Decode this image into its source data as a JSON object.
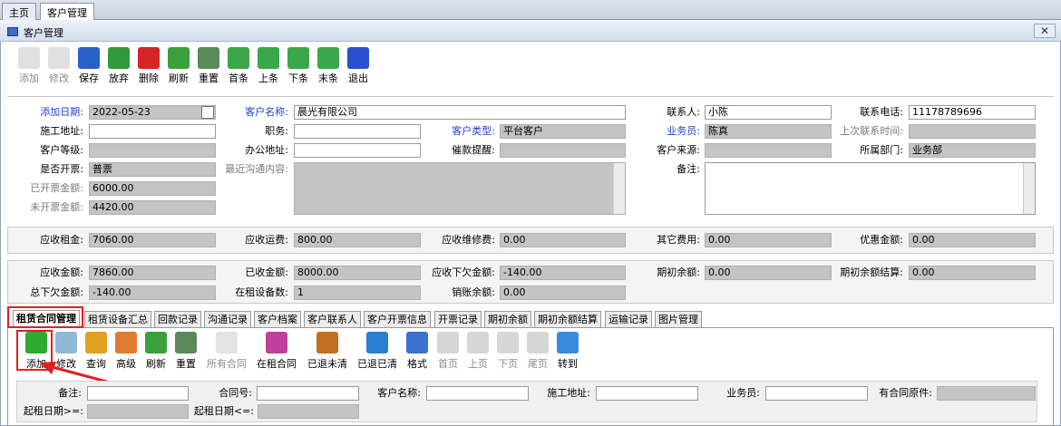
{
  "top_tabs": [
    "主页",
    "客户管理"
  ],
  "window_title": "客户管理",
  "close_glyph": "✕",
  "toolbar": [
    "添加",
    "修改",
    "保存",
    "放弃",
    "删除",
    "刷新",
    "重置",
    "首条",
    "上条",
    "下条",
    "末条",
    "退出"
  ],
  "colors": {
    "accent_blue": "#1e3fd0",
    "highlight_red": "#e02020",
    "add_green": "#2eaa2e"
  },
  "form": {
    "add_date_label": "添加日期:",
    "add_date": "2022-05-23",
    "customer_name_label": "客户名称:",
    "customer_name": "晨光有限公司",
    "contact_label": "联系人:",
    "contact": "小陈",
    "phone_label": "联系电话:",
    "phone": "11178789696",
    "site_address_label": "施工地址:",
    "site_address": "",
    "position_label": "职务:",
    "position": "",
    "customer_type_label": "客户类型:",
    "customer_type": "平台客户",
    "salesman_label": "业务员:",
    "salesman": "陈真",
    "last_contact_label": "上次联系时间:",
    "last_contact": "",
    "customer_level_label": "客户等级:",
    "customer_level": "",
    "office_address_label": "办公地址:",
    "office_address": "",
    "reminder_label": "催款提醒:",
    "reminder": "",
    "source_label": "客户来源:",
    "source": "",
    "department_label": "所属部门:",
    "department": "业务部",
    "invoice_label": "是否开票:",
    "invoice": "普票",
    "recent_comm_label": "最近沟通内容:",
    "recent_comm": "",
    "remark_label": "备注:",
    "remark": "",
    "invoiced_amount_label": "已开票金额:",
    "invoiced_amount": "6000.00",
    "uninvoiced_amount_label": "未开票金额:",
    "uninvoiced_amount": "4420.00"
  },
  "fees": {
    "rent_label": "应收租金:",
    "rent": "7060.00",
    "freight_label": "应收运费:",
    "freight": "800.00",
    "repair_label": "应收维修费:",
    "repair": "0.00",
    "other_label": "其它费用:",
    "other": "0.00",
    "discount_label": "优惠金额:",
    "discount": "0.00"
  },
  "summary": {
    "receivable_label": "应收金额:",
    "receivable": "7860.00",
    "received_label": "已收金额:",
    "received": "8000.00",
    "owed_label": "应收下欠金额:",
    "owed": "-140.00",
    "opening_label": "期初余额:",
    "opening": "0.00",
    "opening_settled_label": "期初余额结算:",
    "opening_settled": "0.00",
    "total_owed_label": "总下欠金额:",
    "total_owed": "-140.00",
    "equipment_label": "在租设备数:",
    "equipment": "1",
    "writeoff_label": "销账余额:",
    "writeoff": "0.00"
  },
  "sub_tabs": [
    "租赁合同管理",
    "租赁设备汇总",
    "回款记录",
    "沟通记录",
    "客户档案",
    "客户联系人",
    "客户开票信息",
    "开票记录",
    "期初余额",
    "期初余额结算",
    "运输记录",
    "图片管理"
  ],
  "sub_toolbar": [
    "添加",
    "修改",
    "查询",
    "高级",
    "刷新",
    "重置",
    "所有合同",
    "在租合同",
    "已退未清",
    "已退已清",
    "格式",
    "首页",
    "上页",
    "下页",
    "尾页",
    "转到"
  ],
  "filters": {
    "remark_label": "备注:",
    "contract_no_label": "合同号:",
    "customer_name_label": "客户名称:",
    "site_address_label": "施工地址:",
    "salesman_label": "业务员:",
    "has_original_label": "有合同原件:",
    "start_from_label": "起租日期>=:",
    "start_to_label": "起租日期<=:"
  }
}
